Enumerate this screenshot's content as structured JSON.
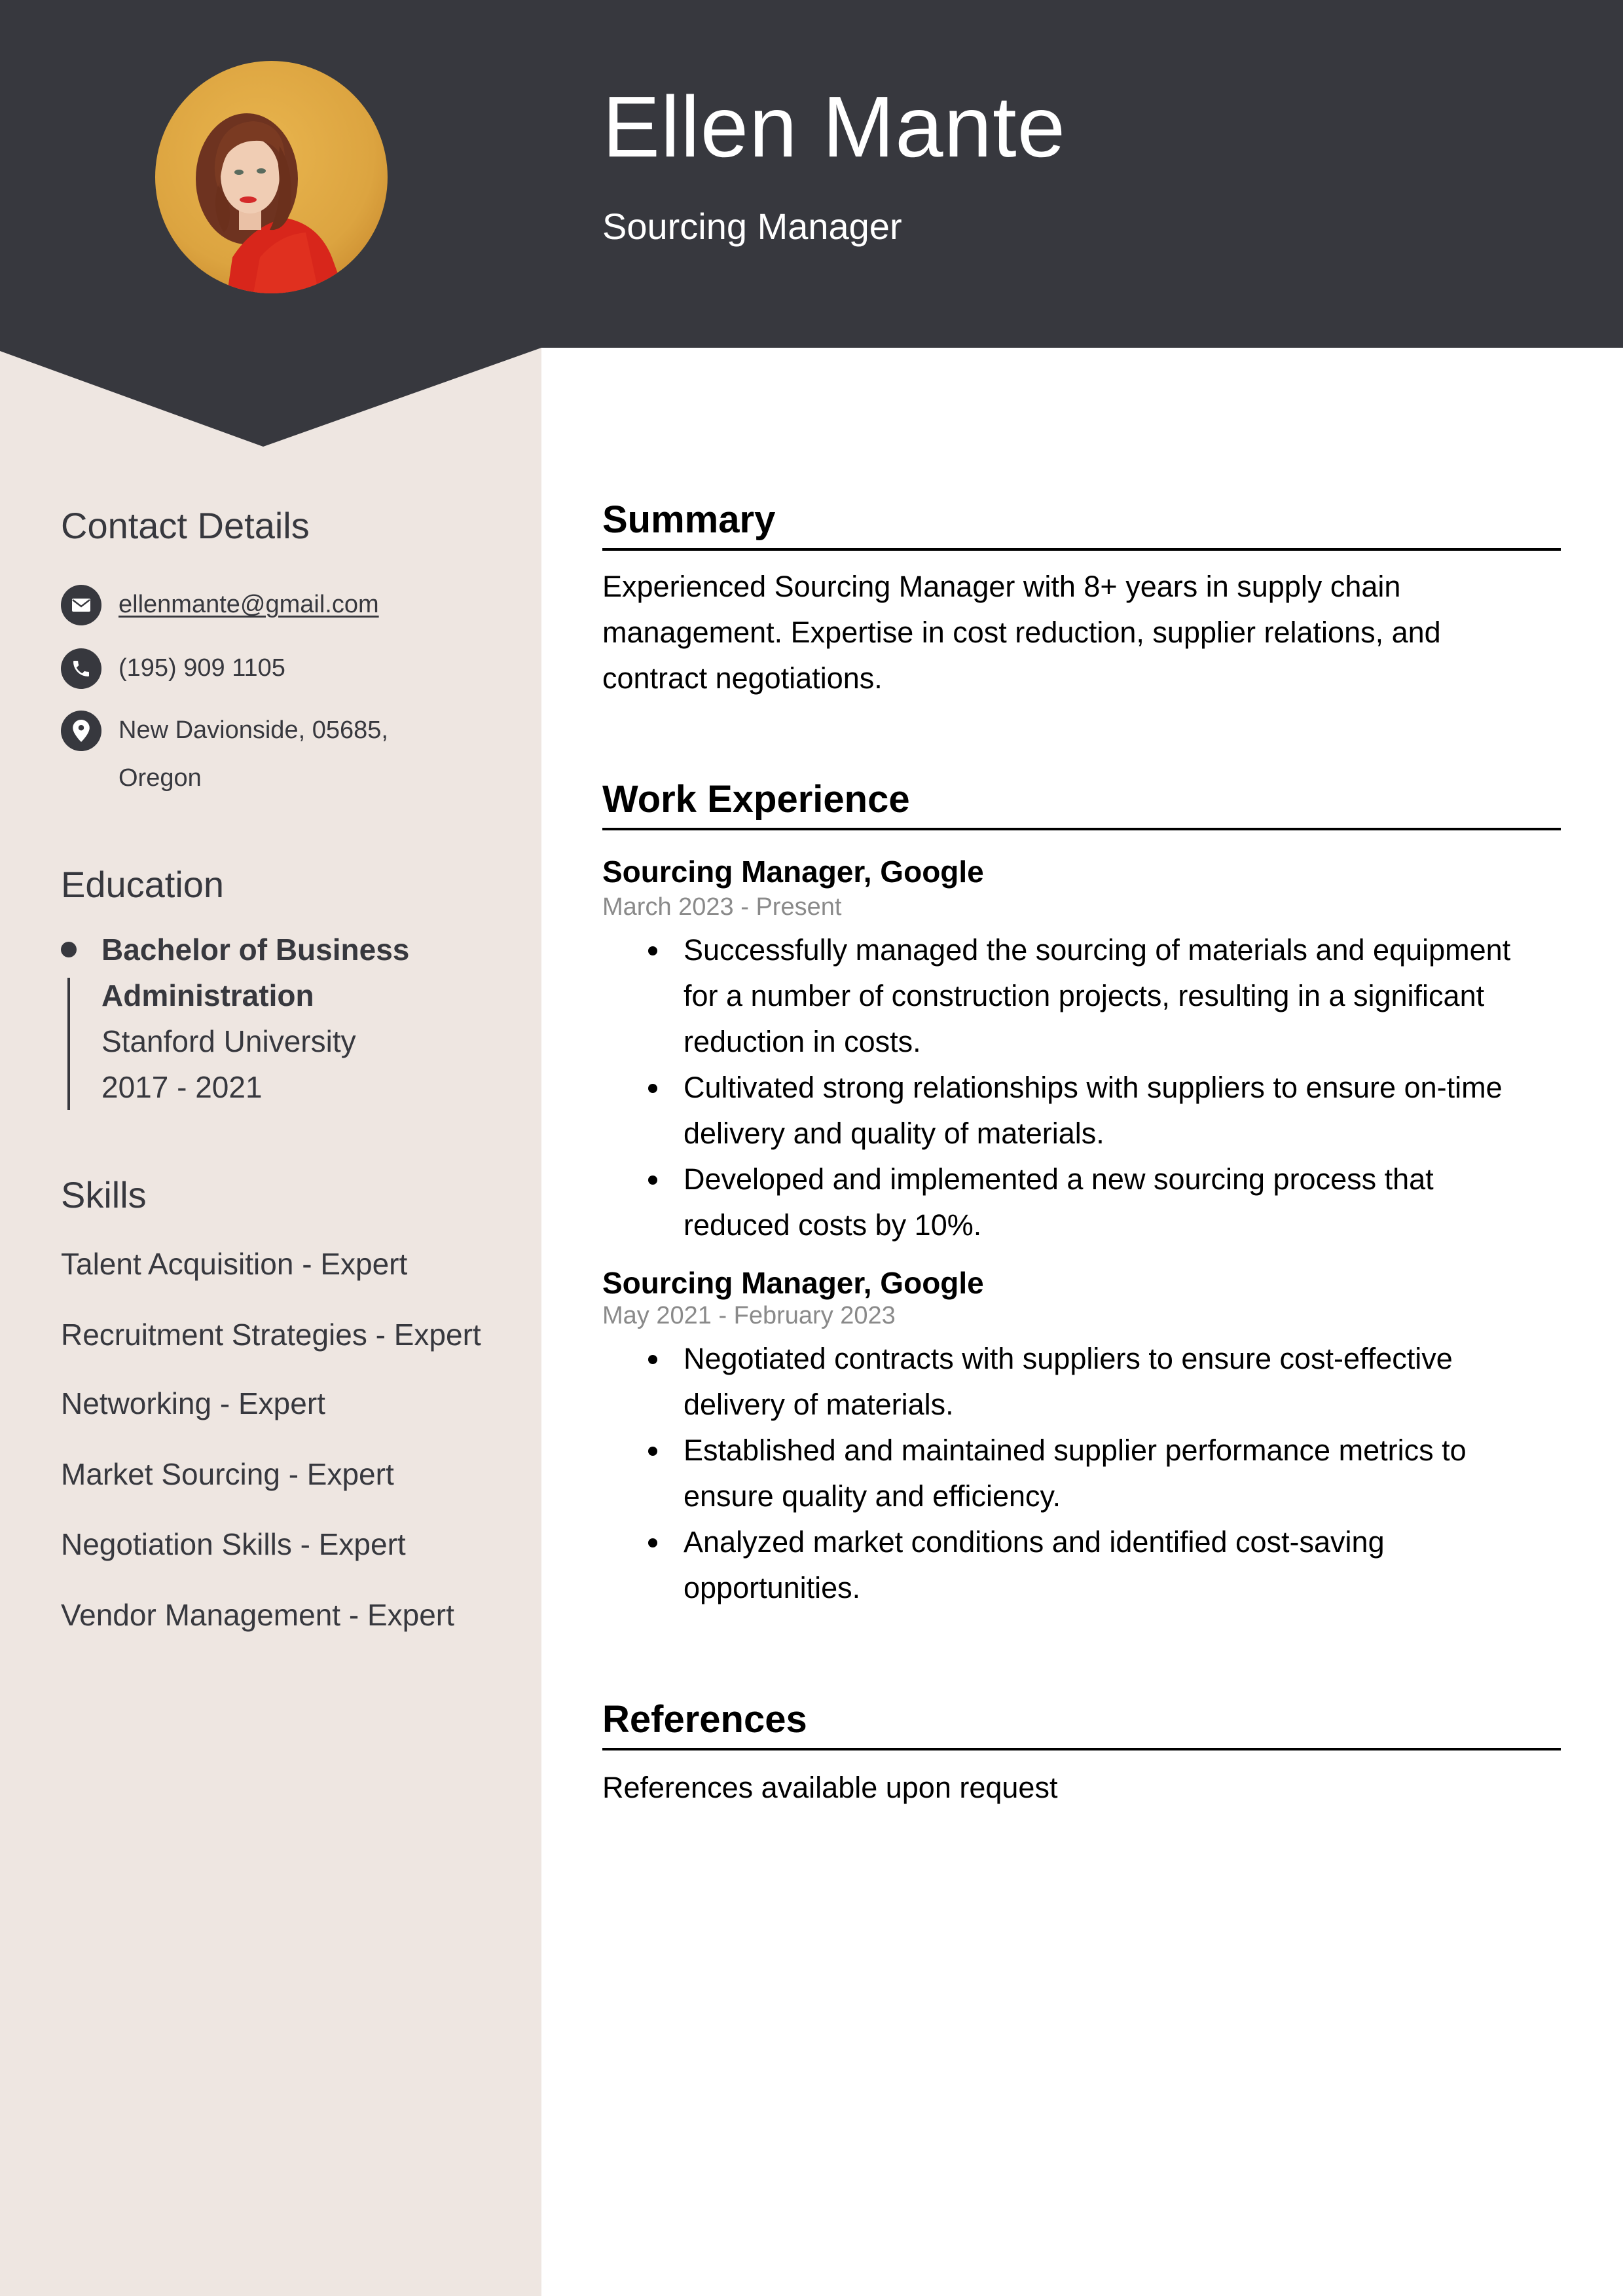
{
  "header": {
    "name": "Ellen Mante",
    "job_title": "Sourcing Manager",
    "photo_alt": "Profile photo"
  },
  "colors": {
    "header_bg": "#37383e",
    "sidebar_bg": "#eee6e1",
    "date_text": "#8a8a8a"
  },
  "sidebar": {
    "contact": {
      "heading": "Contact Details",
      "email": "ellenmante@gmail.com",
      "phone": "(195) 909 1105",
      "address_line1": "New Davionside, 05685,",
      "address_line2": "Oregon",
      "icons": [
        "envelope-icon",
        "phone-icon",
        "map-pin-icon"
      ]
    },
    "education": {
      "heading": "Education",
      "degree_line1": "Bachelor of Business",
      "degree_line2": "Administration",
      "school": "Stanford University",
      "years": "2017 - 2021"
    },
    "skills": {
      "heading": "Skills",
      "items": [
        "Talent Acquisition - Expert",
        "Recruitment Strategies - Expert",
        "Networking - Expert",
        "Market Sourcing - Expert",
        "Negotiation Skills - Expert",
        "Vendor Management - Expert"
      ]
    }
  },
  "main": {
    "summary": {
      "heading": "Summary",
      "text": "Experienced Sourcing Manager with 8+ years in supply chain management. Expertise in cost reduction, supplier relations, and contract negotiations."
    },
    "work": {
      "heading": "Work Experience",
      "jobs": [
        {
          "title": "Sourcing Manager, Google",
          "dates": "March 2023 - Present",
          "bullets": [
            "Successfully managed the sourcing of materials and equipment for a number of construction projects, resulting in a significant reduction in costs.",
            "Cultivated strong relationships with suppliers to ensure on-time delivery and quality of materials.",
            "Developed and implemented a new sourcing process that reduced costs by 10%."
          ]
        },
        {
          "title": "Sourcing Manager, Google",
          "dates": "May 2021 - February 2023",
          "bullets": [
            "Negotiated contracts with suppliers to ensure cost-effective delivery of materials.",
            "Established and maintained supplier performance metrics to ensure quality and efficiency.",
            "Analyzed market conditions and identified cost-saving opportunities."
          ]
        }
      ]
    },
    "references": {
      "heading": "References",
      "text": "References available upon request"
    }
  }
}
